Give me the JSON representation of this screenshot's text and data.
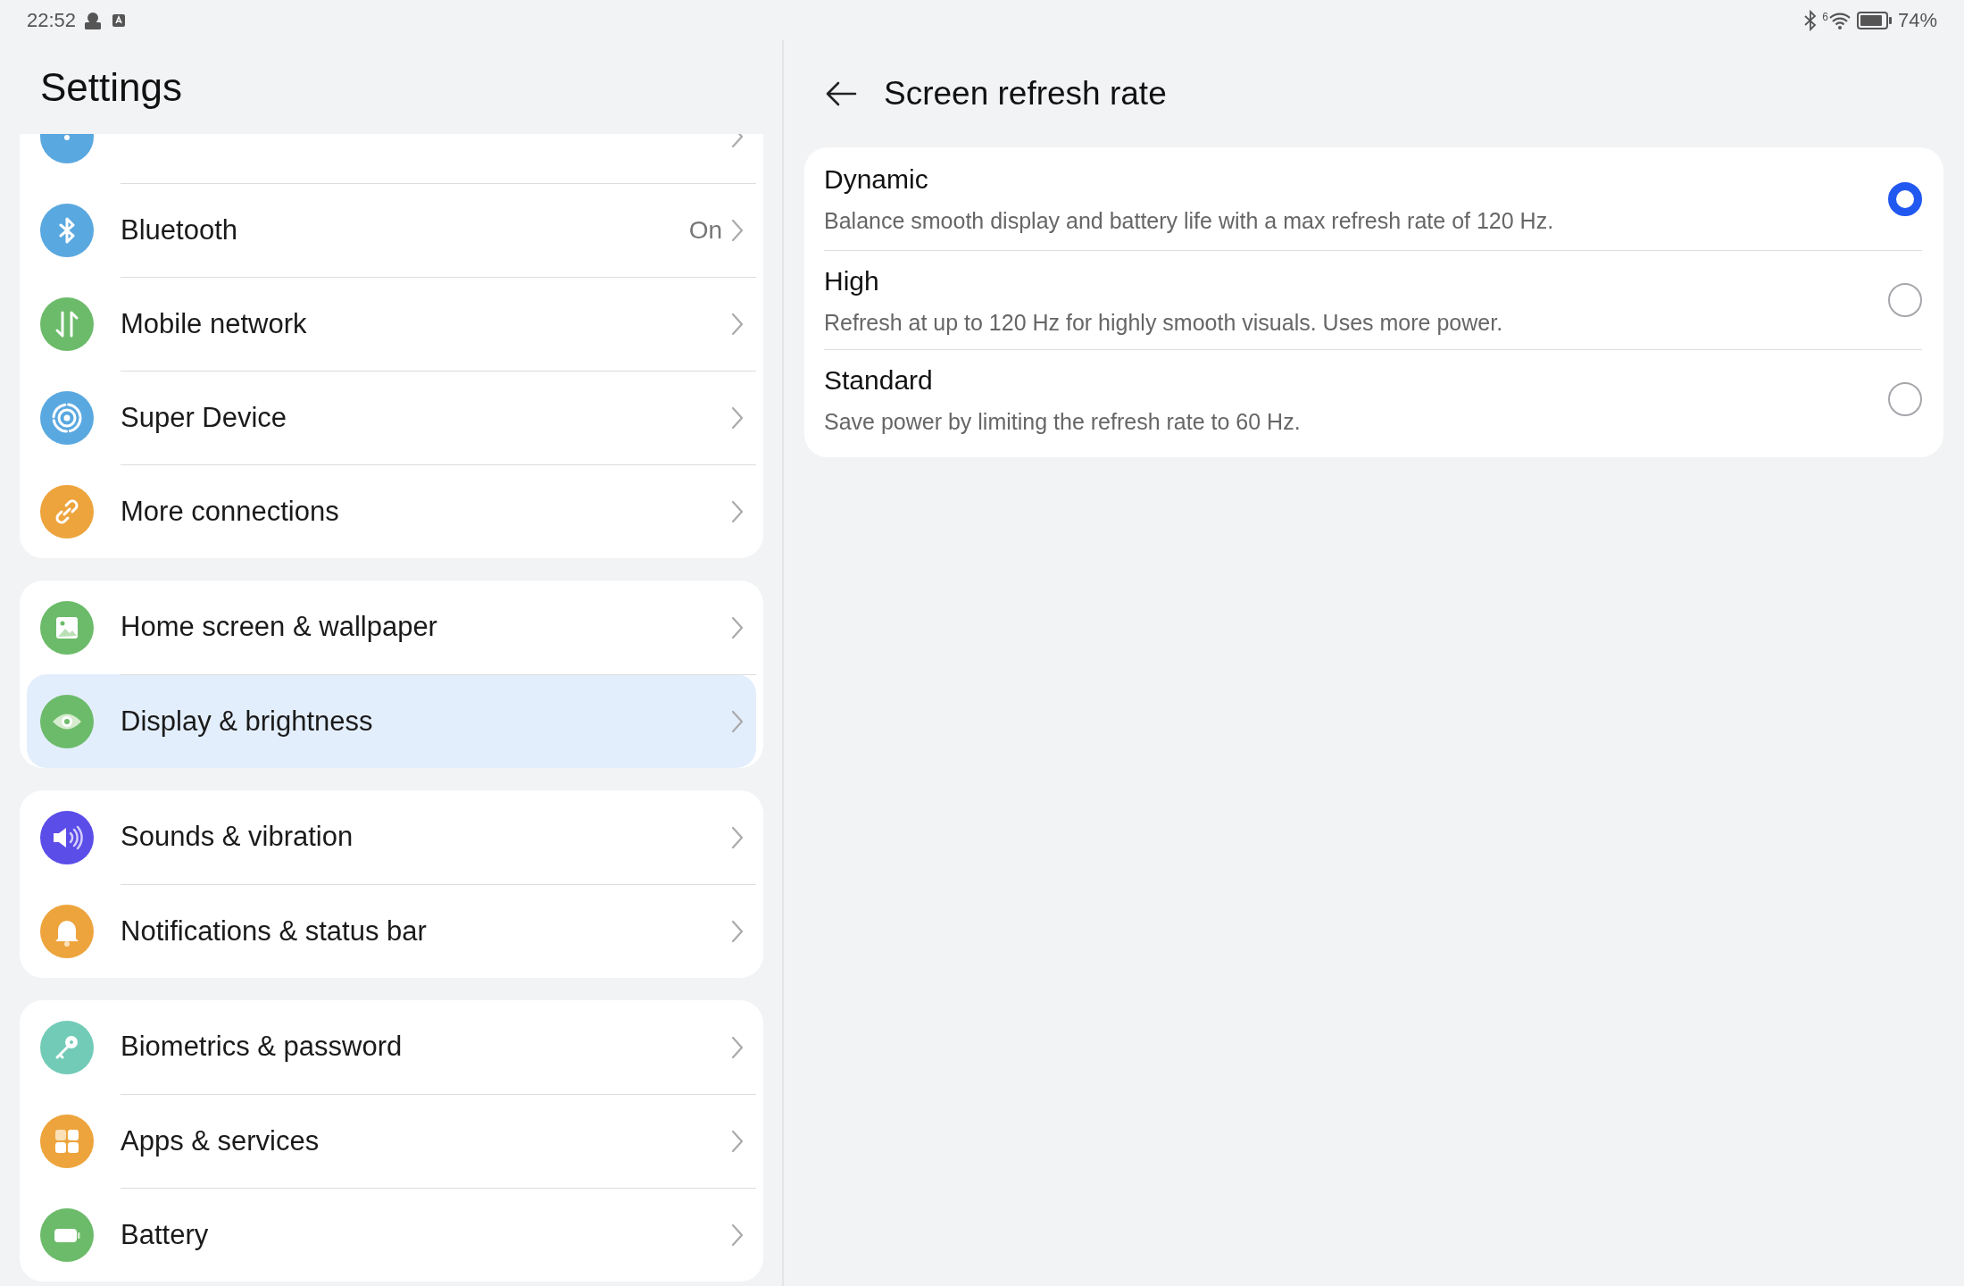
{
  "status_bar": {
    "time": "22:52",
    "wifi_badge": "6",
    "battery_text": "74%"
  },
  "settings": {
    "title": "Settings",
    "groups": [
      {
        "items": [
          {
            "color": "#5aa8e0",
            "selected": false
          },
          {
            "label": "Bluetooth",
            "value": "On",
            "color": "#5aa8e0",
            "selected": false
          },
          {
            "label": "Mobile network",
            "color": "#6cbb6a",
            "selected": false
          },
          {
            "label": "Super Device",
            "color": "#5aa8e0",
            "selected": false
          },
          {
            "label": "More connections",
            "color": "#eda43c",
            "selected": false
          }
        ]
      },
      {
        "items": [
          {
            "label": "Home screen & wallpaper",
            "color": "#6cbb6a",
            "selected": false
          },
          {
            "label": "Display & brightness",
            "color": "#6cbb6a",
            "selected": true
          }
        ]
      },
      {
        "items": [
          {
            "label": "Sounds & vibration",
            "color": "#5b4de8",
            "selected": false
          },
          {
            "label": "Notifications & status bar",
            "color": "#eda43c",
            "selected": false
          }
        ]
      },
      {
        "items": [
          {
            "label": "Biometrics & password",
            "color": "#72cbb7",
            "selected": false
          },
          {
            "label": "Apps & services",
            "color": "#eda43c",
            "selected": false
          },
          {
            "label": "Battery",
            "color": "#6cbb6a",
            "selected": false
          }
        ]
      }
    ]
  },
  "detail": {
    "title": "Screen refresh rate",
    "options": [
      {
        "title": "Dynamic",
        "description": "Balance smooth display and battery life with a max refresh rate of 120 Hz.",
        "selected": true
      },
      {
        "title": "High",
        "description": "Refresh at up to 120 Hz for highly smooth visuals. Uses more power.",
        "selected": false
      },
      {
        "title": "Standard",
        "description": "Save power by limiting the refresh rate to 60 Hz.",
        "selected": false
      }
    ]
  }
}
